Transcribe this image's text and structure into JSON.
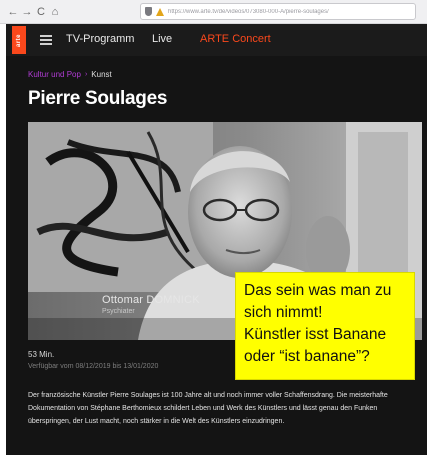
{
  "browser": {
    "back": "←",
    "forward": "→",
    "reload": "C",
    "home": "⌂",
    "url": "https://www.arte.tv/de/videos/073080-000-A/pierre-soulages/"
  },
  "header": {
    "logo": "arte",
    "nav": [
      "TV-Programm",
      "Live",
      "ARTE Concert"
    ]
  },
  "breadcrumb": {
    "items": [
      "Kultur und Pop",
      "Kunst"
    ],
    "separator": "›"
  },
  "page_title": "Pierre Soulages",
  "video": {
    "name_caption": "Ottomar DOMNICK",
    "role_caption": "Psychiater"
  },
  "annotation": {
    "lines": [
      "Das sein was man zu",
      "sich nimmt!",
      "Künstler isst Banane",
      "oder “ist banane”?"
    ]
  },
  "meta": {
    "duration": "53 Min.",
    "availability": "Verfügbar vom 08/12/2019 bis 13/01/2020"
  },
  "description": "Der französische Künstler Pierre Soulages ist 100 Jahre alt und noch immer voller Schaffensdrang. Die meisterhafte Dokumentation von Stéphane Berthomieux schildert Leben und Werk des Künstlers und lässt genau den Funken überspringen, der Lust macht, noch stärker in die Welt des Künstlers einzudringen.",
  "colors": {
    "accent": "#fa481c",
    "breadcrumb": "#b03cd4",
    "annotation_bg": "#ffff00"
  }
}
